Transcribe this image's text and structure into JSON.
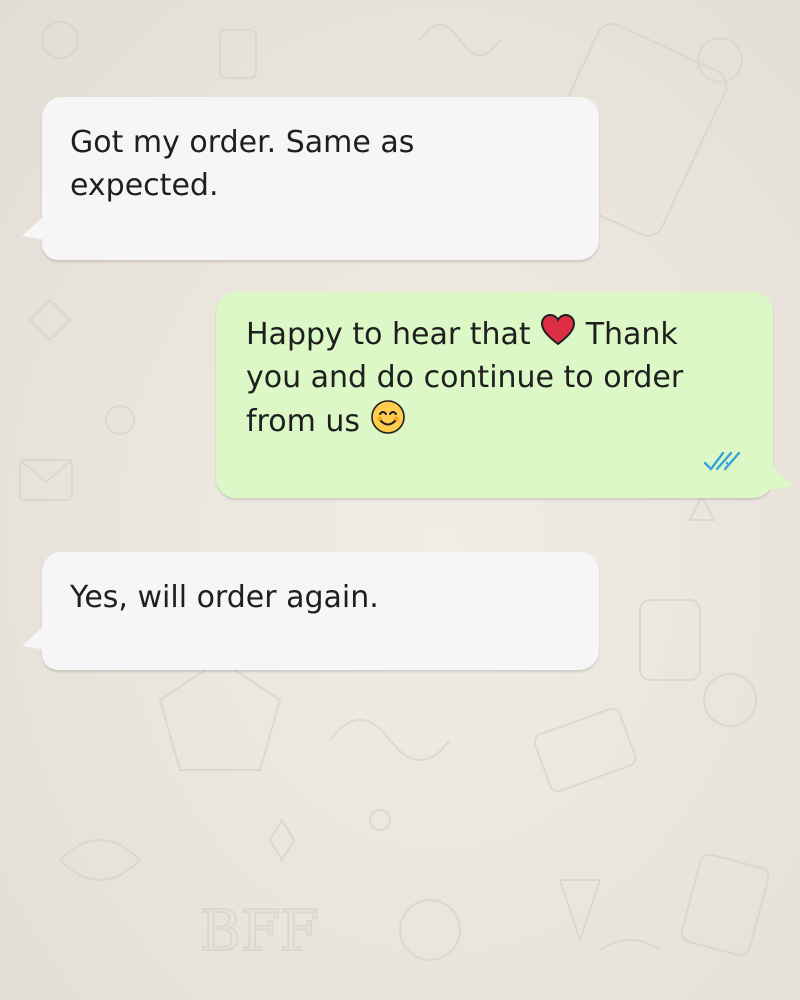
{
  "conversation": {
    "messages": [
      {
        "direction": "incoming",
        "text": "Got my order. Same as\nexpected."
      },
      {
        "direction": "outgoing",
        "text_before_heart": "Happy to hear that ",
        "heart_icon": "red-heart-icon",
        "text_after_heart": " Thank\nyou and do continue to order\nfrom us ",
        "smile_icon": "smiling-face-icon",
        "status_icon": "double-check-read-icon",
        "status_color": "#34a3d9"
      },
      {
        "direction": "incoming",
        "text": "Yes, will order again."
      }
    ]
  },
  "colors": {
    "incoming_bubble": "#f6f6f6",
    "outgoing_bubble": "#dcf8c6",
    "background": "#ece7df"
  }
}
